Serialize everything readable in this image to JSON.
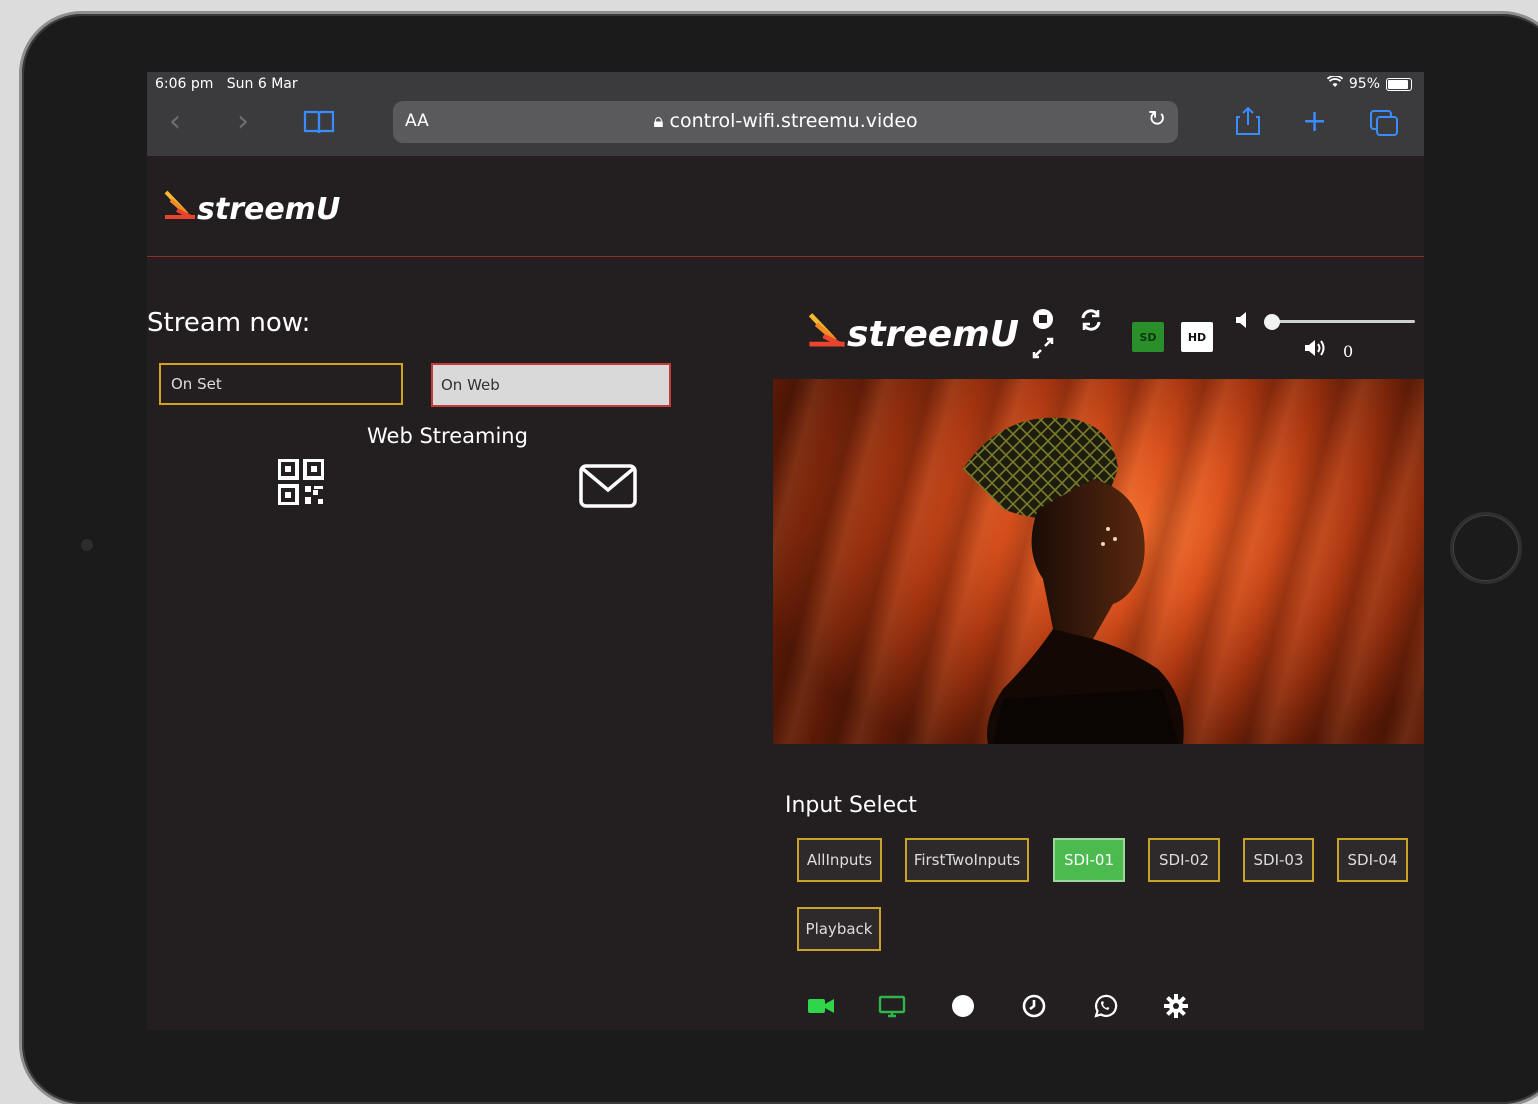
{
  "status_bar": {
    "time": "6:06 pm",
    "date": "Sun 6 Mar",
    "battery": "95%"
  },
  "browser": {
    "text_size_label": "AA",
    "url": "control-wifi.streemu.video"
  },
  "brand": {
    "name": "streemU"
  },
  "stream_now": {
    "title": "Stream now:",
    "on_set_label": "On Set",
    "on_web_label": "On Web",
    "web_streaming_label": "Web Streaming"
  },
  "player": {
    "sd_label": "SD",
    "hd_label": "HD",
    "volume_value": "0",
    "volume_level": 0
  },
  "input_select": {
    "title": "Input Select",
    "items": [
      {
        "label": "AllInputs",
        "active": false
      },
      {
        "label": "FirstTwoInputs",
        "active": false
      },
      {
        "label": "SDI-01",
        "active": true
      },
      {
        "label": "SDI-02",
        "active": false
      },
      {
        "label": "SDI-03",
        "active": false
      },
      {
        "label": "SDI-04",
        "active": false
      },
      {
        "label": "Playback",
        "active": false
      }
    ]
  },
  "bottom_nav": [
    "video-camera-icon",
    "monitor-icon",
    "record-dot-icon",
    "clock-icon",
    "whatsapp-icon",
    "gear-icon"
  ],
  "colors": {
    "accent_green": "#4cbb4f",
    "button_border": "#c9a227",
    "header_rule": "#9b2a2a",
    "safari_blue": "#3a8dff"
  }
}
